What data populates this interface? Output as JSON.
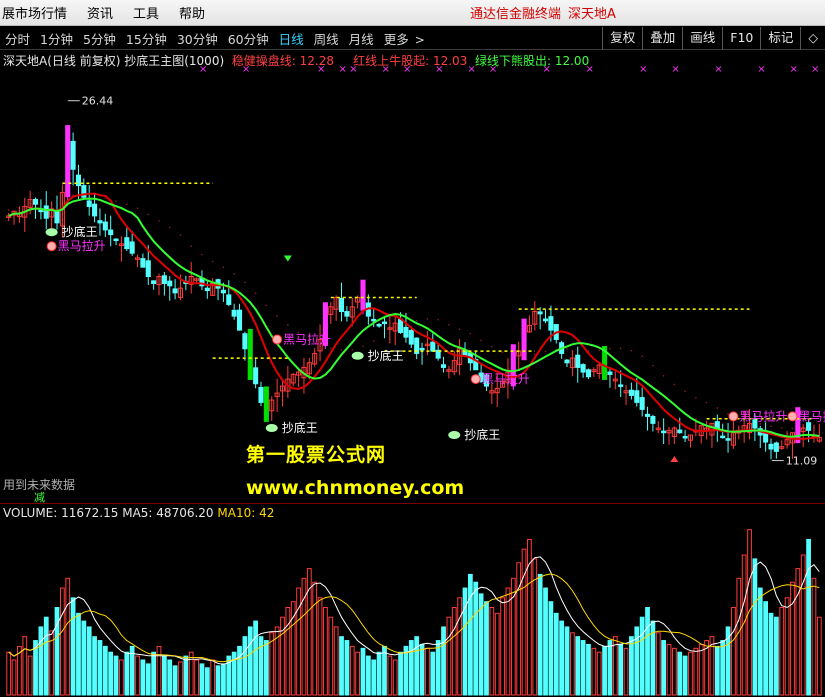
{
  "menubar": {
    "items": [
      "展市场行情",
      "资讯",
      "工具",
      "帮助"
    ],
    "promo_tdx": "通达信金融终端",
    "promo_stock": "深天地A"
  },
  "toolbar": {
    "periods": [
      "分时",
      "1分钟",
      "5分钟",
      "15分钟",
      "30分钟",
      "60分钟",
      "日线",
      "周线",
      "月线",
      "更多"
    ],
    "active_period": "日线",
    "more_arrow": ">",
    "tools": [
      "复权",
      "叠加",
      "画线",
      "F10",
      "标记",
      "◇"
    ]
  },
  "header": {
    "stock": "深天地A",
    "mode": "(日线 前复权)",
    "formula": "抄底王主图(1000)",
    "stable_label": "稳健操盘线:",
    "stable_value": "12.28",
    "red_label": "红线上牛股起:",
    "red_value": "12.03",
    "green_label": "绿线下熊股出:",
    "green_value": "12.00"
  },
  "annotations": {
    "high_price": "26.44",
    "low_price": "11.09",
    "chaodi": "抄底王",
    "heima": "黑马拉升"
  },
  "watermark": {
    "title": "第一股票公式网",
    "url": "www.chnmoney.com"
  },
  "future_note": "用到未来数据",
  "future_sub": "减",
  "volume": {
    "label": "VOLUME:",
    "value": "11672.15",
    "ma5_label": "MA5:",
    "ma5_value": "48706.20",
    "ma10_label": "MA10:",
    "ma10_value": "42"
  },
  "colors": {
    "up": "#ff3b3b",
    "down": "#54ffff",
    "green_line": "#33ff33",
    "red_line": "#e00000",
    "magenta": "#ff33ff",
    "yellow": "#ffff00",
    "green_bar": "#00e000"
  },
  "chart_data": {
    "type": "candlestick",
    "price_high": 26.44,
    "price_low": 11.09,
    "close": [
      21.5,
      21.7,
      21.6,
      21.9,
      22.2,
      22.0,
      21.7,
      21.4,
      21.8,
      21.2,
      22.5,
      24.6,
      23.5,
      22.8,
      22.3,
      21.9,
      21.5,
      21.2,
      20.9,
      20.7,
      20.5,
      20.3,
      20.1,
      19.9,
      19.7,
      19.3,
      18.9,
      18.6,
      18.9,
      18.6,
      18.5,
      18.2,
      18.4,
      18.6,
      18.9,
      18.8,
      18.5,
      18.3,
      18.6,
      18.4,
      18.2,
      17.7,
      17.2,
      16.6,
      15.8,
      15.0,
      14.3,
      13.5,
      13.2,
      13.6,
      13.9,
      14.2,
      14.5,
      14.7,
      14.8,
      15.0,
      15.2,
      15.6,
      16.2,
      17.0,
      17.6,
      18.0,
      17.4,
      17.2,
      17.6,
      18.0,
      17.8,
      17.2,
      17.0,
      16.8,
      16.9,
      16.7,
      16.9,
      16.5,
      16.3,
      16.0,
      15.6,
      15.8,
      16.0,
      15.7,
      15.4,
      15.0,
      14.9,
      15.3,
      15.8,
      15.5,
      15.2,
      14.9,
      14.4,
      14.2,
      14.0,
      14.1,
      14.4,
      14.8,
      15.2,
      15.7,
      16.3,
      16.8,
      17.4,
      17.3,
      17.0,
      16.6,
      16.2,
      15.6,
      15.2,
      15.4,
      15.0,
      14.8,
      14.6,
      14.9,
      15.1,
      15.0,
      14.7,
      14.5,
      14.2,
      14.0,
      13.8,
      13.5,
      13.2,
      12.9,
      12.6,
      12.4,
      12.2,
      12.3,
      12.4,
      12.2,
      12.0,
      12.1,
      12.3,
      12.5,
      12.4,
      12.6,
      12.3,
      12.0,
      11.9,
      12.2,
      12.3,
      12.5,
      12.6,
      12.4,
      12.1,
      11.8,
      11.5,
      11.4,
      11.6,
      11.9,
      12.2,
      12.5,
      12.4,
      12.3,
      12.1,
      12.0
    ],
    "volume": [
      22,
      18,
      25,
      30,
      20,
      28,
      35,
      40,
      33,
      45,
      55,
      60,
      50,
      42,
      38,
      35,
      30,
      28,
      25,
      22,
      20,
      18,
      22,
      25,
      20,
      18,
      16,
      22,
      25,
      20,
      18,
      15,
      17,
      20,
      22,
      18,
      16,
      14,
      18,
      15,
      16,
      20,
      22,
      25,
      30,
      35,
      38,
      30,
      28,
      32,
      35,
      40,
      45,
      48,
      55,
      60,
      65,
      58,
      50,
      45,
      40,
      35,
      30,
      28,
      25,
      22,
      24,
      20,
      18,
      22,
      25,
      20,
      18,
      22,
      25,
      28,
      30,
      26,
      24,
      22,
      28,
      35,
      40,
      45,
      50,
      55,
      62,
      58,
      52,
      48,
      45,
      42,
      50,
      55,
      60,
      68,
      75,
      80,
      70,
      62,
      55,
      48,
      42,
      38,
      35,
      32,
      30,
      28,
      26,
      24,
      22,
      25,
      28,
      30,
      26,
      24,
      30,
      35,
      40,
      45,
      38,
      32,
      28,
      26,
      24,
      22,
      20,
      22,
      24,
      26,
      28,
      30,
      25,
      28,
      35,
      45,
      60,
      72,
      85,
      70,
      55,
      48,
      42,
      40,
      45,
      50,
      58,
      65,
      72,
      80,
      60,
      40
    ]
  }
}
